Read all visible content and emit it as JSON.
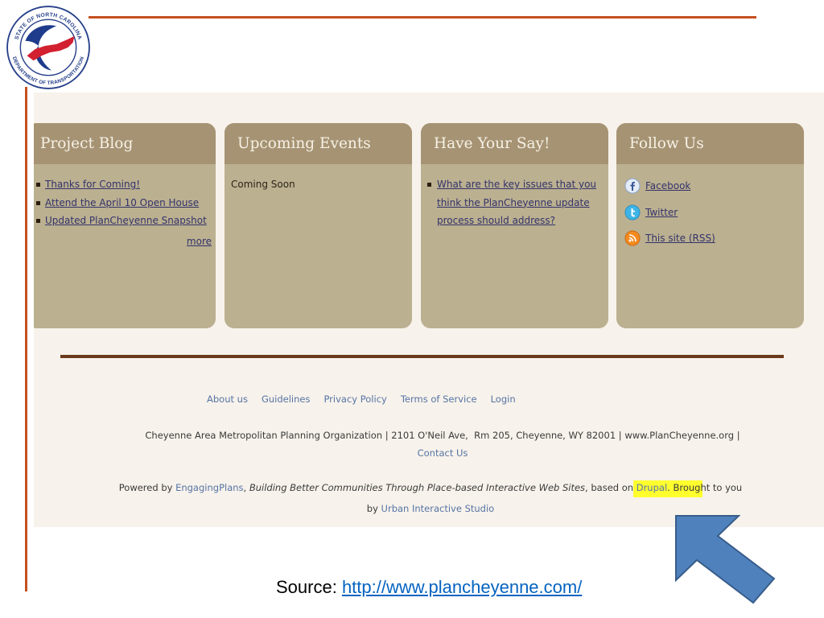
{
  "logo": {
    "top_text": "STATE OF NORTH CAROLINA",
    "bottom_text": "DEPARTMENT OF TRANSPORTATION"
  },
  "colors": {
    "rule": "#c5501f",
    "panel_header": "#a69373",
    "panel_body": "#bbb090",
    "page_background": "#f7f2eb",
    "divider": "#6a3a1a",
    "link": "#33336b",
    "footer_link": "#5674a6",
    "highlight": "#ffff2e",
    "arrow": "#4f81bd",
    "source_link": "#0563c1"
  },
  "panels": {
    "project_blog": {
      "title": "Project Blog",
      "items": [
        "Thanks for Coming!",
        "Attend the April 10 Open House",
        "Updated PlanCheyenne Snapshot"
      ],
      "more": "more"
    },
    "upcoming_events": {
      "title": "Upcoming Events",
      "text": "Coming Soon"
    },
    "have_your_say": {
      "title": "Have Your Say!",
      "items": [
        "What are the key issues that you think the PlanCheyenne update process should address?"
      ]
    },
    "follow_us": {
      "title": "Follow Us",
      "links": [
        {
          "label": "Facebook",
          "icon": "facebook-icon"
        },
        {
          "label": "Twitter",
          "icon": "twitter-icon"
        },
        {
          "label": "This site (RSS)",
          "icon": "rss-icon"
        }
      ]
    }
  },
  "footer": {
    "links": [
      "About us",
      "Guidelines",
      "Privacy Policy",
      "Terms of Service",
      "Login"
    ],
    "address": "Cheyenne Area Metropolitan Planning Organization | 2101 O'Neil Ave,  Rm 205, Cheyenne, WY 82001 | www.PlanCheyenne.org |",
    "contact": "Contact Us",
    "powered": {
      "prefix": "Powered by ",
      "engagingplans": "EngagingPlans",
      "sep": ", ",
      "tagline": "Building Better Communities Through Place-based Interactive Web Sites",
      "based_on": ", based on ",
      "drupal": "Drupal",
      "brought": ". Brought to you",
      "by": "by ",
      "urban": "Urban Interactive Studio"
    }
  },
  "annotation": {
    "arrow_icon": "arrow-up-left-icon"
  },
  "source": {
    "label": "Source: ",
    "url": "http://www.plancheyenne.com/"
  }
}
